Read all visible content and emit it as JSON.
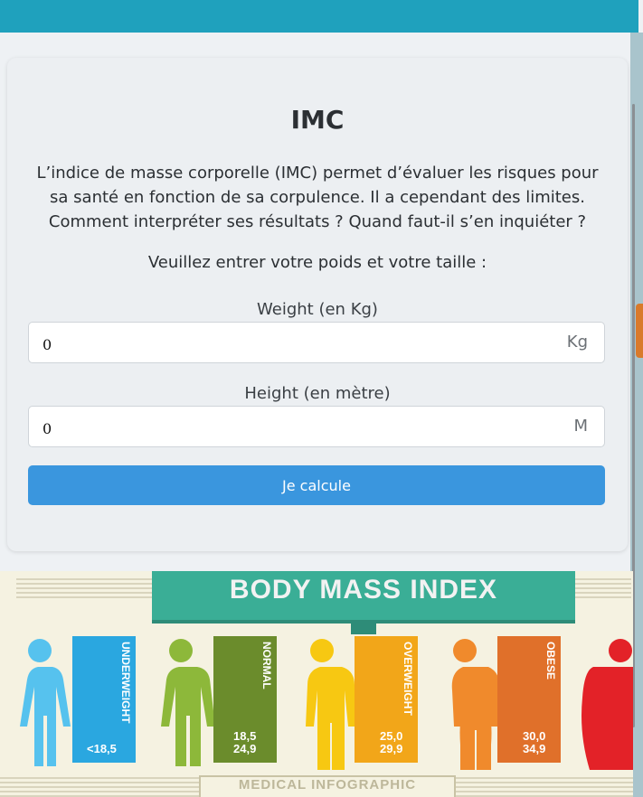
{
  "imc": {
    "title": "IMC",
    "intro": "L’indice de masse corporelle (IMC) permet d’évaluer les risques pour sa santé en fonction de sa corpulence. Il a cependant des limites. Comment interpréter ses résultats ? Quand faut-il s’en inquiéter ?",
    "instruction": "Veuillez entrer votre poids et votre taille :",
    "weight": {
      "label": "Weight (en Kg)",
      "value": "0",
      "unit": "Kg"
    },
    "height": {
      "label": "Height (en mètre)",
      "value": "0",
      "unit": "M"
    },
    "submit_label": "Je calcule"
  },
  "infographic": {
    "title": "BODY MASS INDEX",
    "footer": "MEDICAL INFOGRAPHIC",
    "categories": [
      {
        "label": "UNDERWEIGHT",
        "range": "<18,5",
        "color": "#2aa7e0"
      },
      {
        "label": "NORMAL",
        "range_low": "18,5",
        "range_high": "24,9",
        "color": "#6b8c2c"
      },
      {
        "label": "OVERWEIGHT",
        "range_low": "25,0",
        "range_high": "29,9",
        "color": "#f2a619"
      },
      {
        "label": "OBESE",
        "range_low": "30,0",
        "range_high": "34,9",
        "color": "#e0702a"
      }
    ]
  }
}
